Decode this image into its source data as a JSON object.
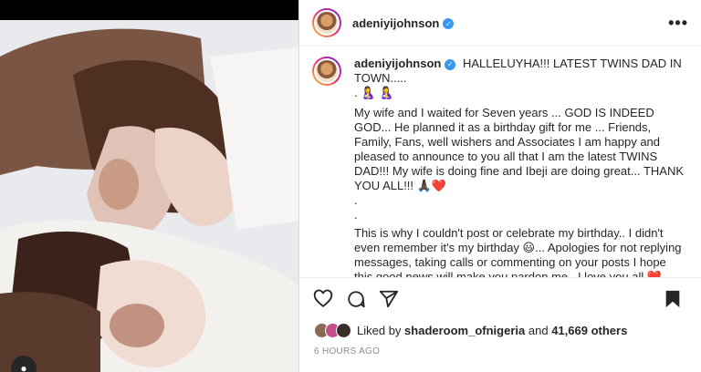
{
  "post": {
    "username": "adeniyijohnson",
    "verified_icon": "verified-badge-icon",
    "more_icon": "more-options-icon",
    "caption_line1": "HALLELUYHA!!! LATEST TWINS DAD IN TOWN.....",
    "caption_emoji_line": ". 🤱 🤱",
    "caption_para1": "My wife and I waited for Seven years ... GOD IS INDEED GOD... He planned it as a birthday gift for me ... Friends, Family, Fans, well wishers and Associates I am happy and pleased to announce to you all that I am the latest TWINS DAD!!! My wife is doing fine and Ibeji are doing great... THANK YOU ALL!!! 🙏🏿❤️",
    "caption_dot1": ".",
    "caption_dot2": ".",
    "caption_para2": "This is why I couldn't post or celebrate my birthday.. I didn't even remember it's my birthday 😃... Apologies for not replying messages, taking calls or commenting on your posts I hope this good news will make you pardon me.. I love you all ❤️...",
    "likes_prefix": "Liked by",
    "liker": "shaderoom_ofnigeria",
    "likes_mid": "and",
    "likes_count": "41,669 others",
    "timestamp": "6 HOURS AGO"
  },
  "colors": {
    "verified": "#3897f0",
    "heart": "#ed4956",
    "muted": "#8e8e8e"
  }
}
